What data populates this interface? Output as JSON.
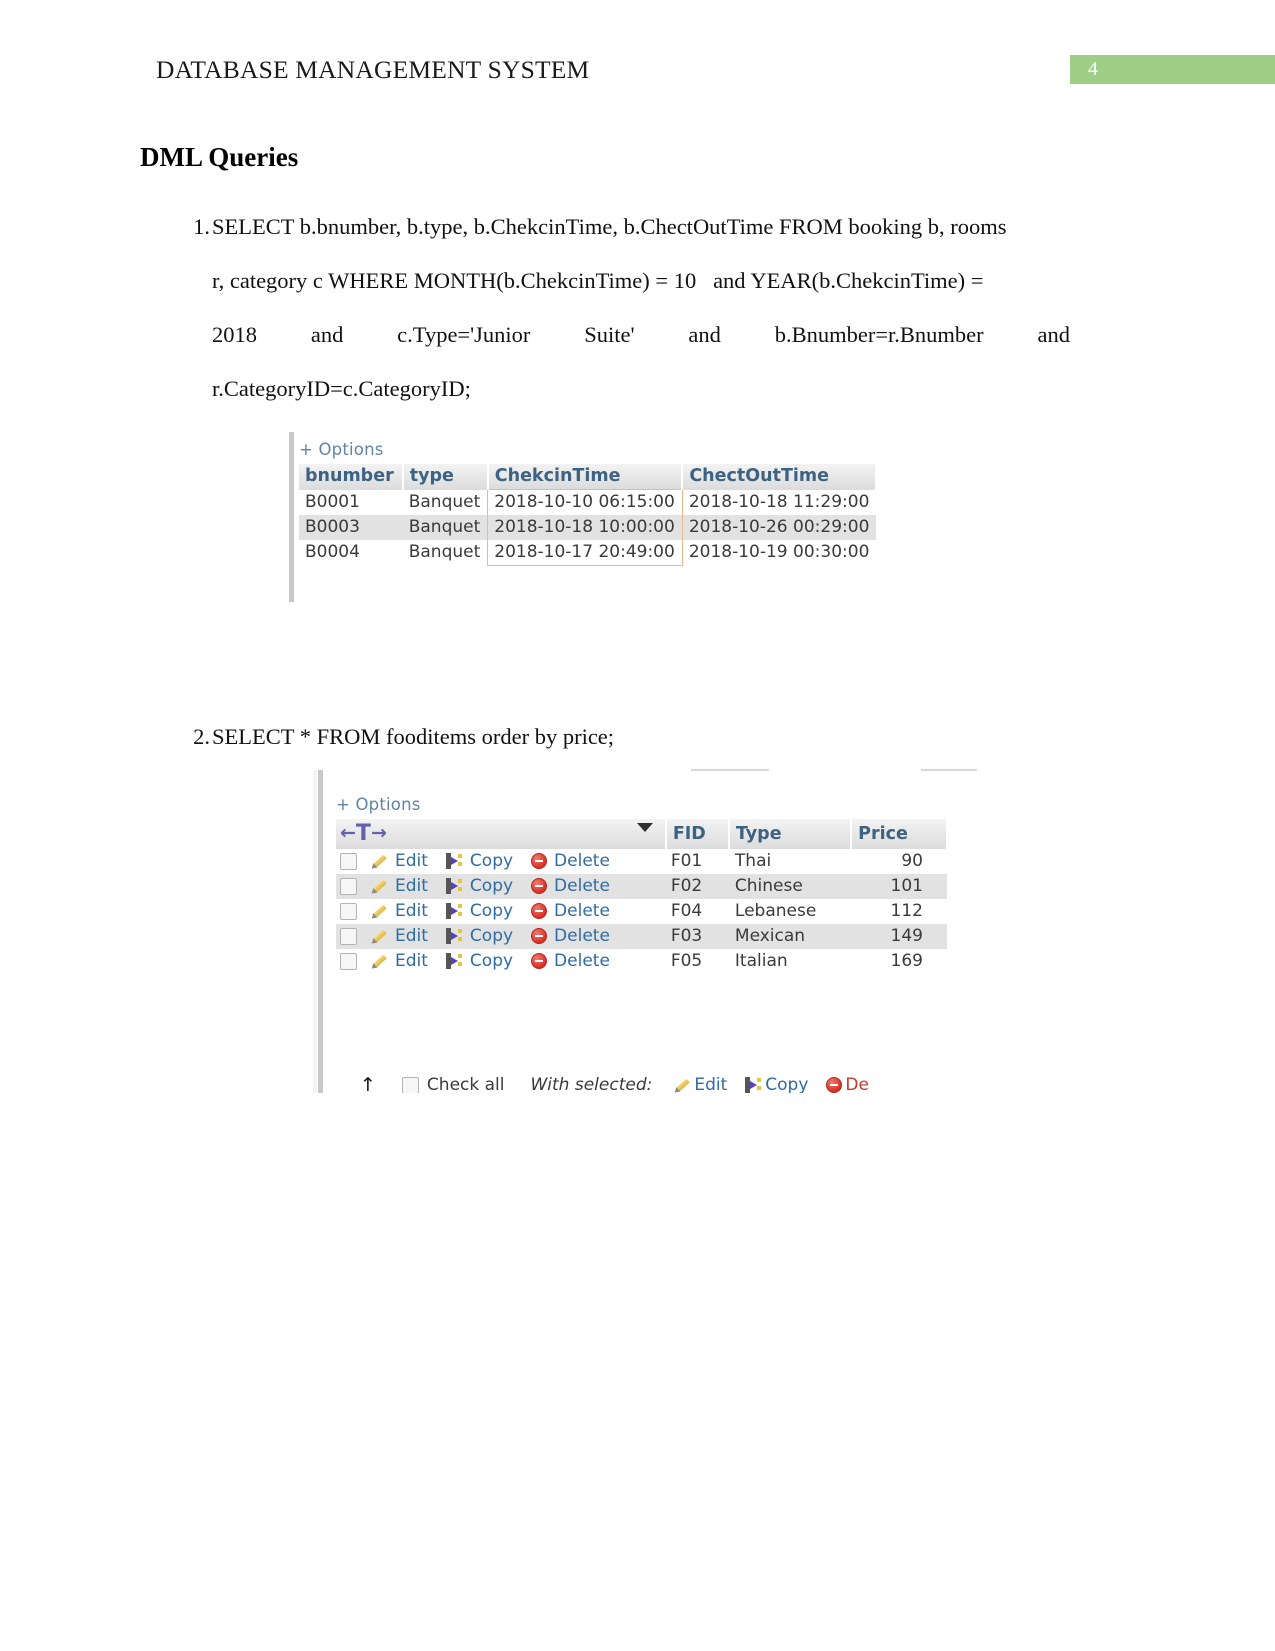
{
  "header": {
    "title": "DATABASE MANAGEMENT SYSTEM",
    "page_number": "4",
    "page_number_bg": "#9fcf86"
  },
  "section": {
    "heading": "DML Queries"
  },
  "queries": [
    {
      "marker": "1.",
      "lines": [
        "SELECT b.bnumber, b.type, b.ChekcinTime, b.ChectOutTime FROM booking b, rooms",
        "r, category c WHERE MONTH(b.ChekcinTime) = 10   and YEAR(b.ChekcinTime) =",
        [
          "2018",
          "and",
          "c.Type='Junior",
          "Suite'",
          "and",
          "b.Bnumber=r.Bnumber",
          "and"
        ],
        "r.CategoryID=c.CategoryID;"
      ]
    },
    {
      "marker": "2.",
      "lines": [
        "SELECT * FROM fooditems order by price;"
      ]
    }
  ],
  "figure1": {
    "options_label": "+ Options",
    "columns": [
      "bnumber",
      "type",
      "ChekcinTime",
      "ChectOutTime"
    ],
    "highlight_column": "ChekcinTime",
    "highlight_border_color": "#f0b78a",
    "rows": [
      [
        "B0001",
        "Banquet",
        "2018-10-10 06:15:00",
        "2018-10-18 11:29:00"
      ],
      [
        "B0003",
        "Banquet",
        "2018-10-18 10:00:00",
        "2018-10-26 00:29:00"
      ],
      [
        "B0004",
        "Banquet",
        "2018-10-17 20:49:00",
        "2018-10-19 00:30:00"
      ]
    ]
  },
  "figure2": {
    "options_label": "+ Options",
    "sort_left_arrow": "←",
    "sort_t_glyph": "T",
    "sort_right_arrow": "→",
    "columns": [
      "FID",
      "Type",
      "Price"
    ],
    "action_labels": {
      "edit": "Edit",
      "copy": "Copy",
      "delete": "Delete"
    },
    "rows": [
      {
        "fid": "F01",
        "type": "Thai",
        "price": "90"
      },
      {
        "fid": "F02",
        "type": "Chinese",
        "price": "101"
      },
      {
        "fid": "F04",
        "type": "Lebanese",
        "price": "112"
      },
      {
        "fid": "F03",
        "type": "Mexican",
        "price": "149"
      },
      {
        "fid": "F05",
        "type": "Italian",
        "price": "169"
      }
    ],
    "footer": {
      "up_arrow": "↑",
      "check_all": "Check all",
      "with_selected": "With selected:",
      "edit": "Edit",
      "copy": "Copy",
      "delete": "De"
    }
  }
}
